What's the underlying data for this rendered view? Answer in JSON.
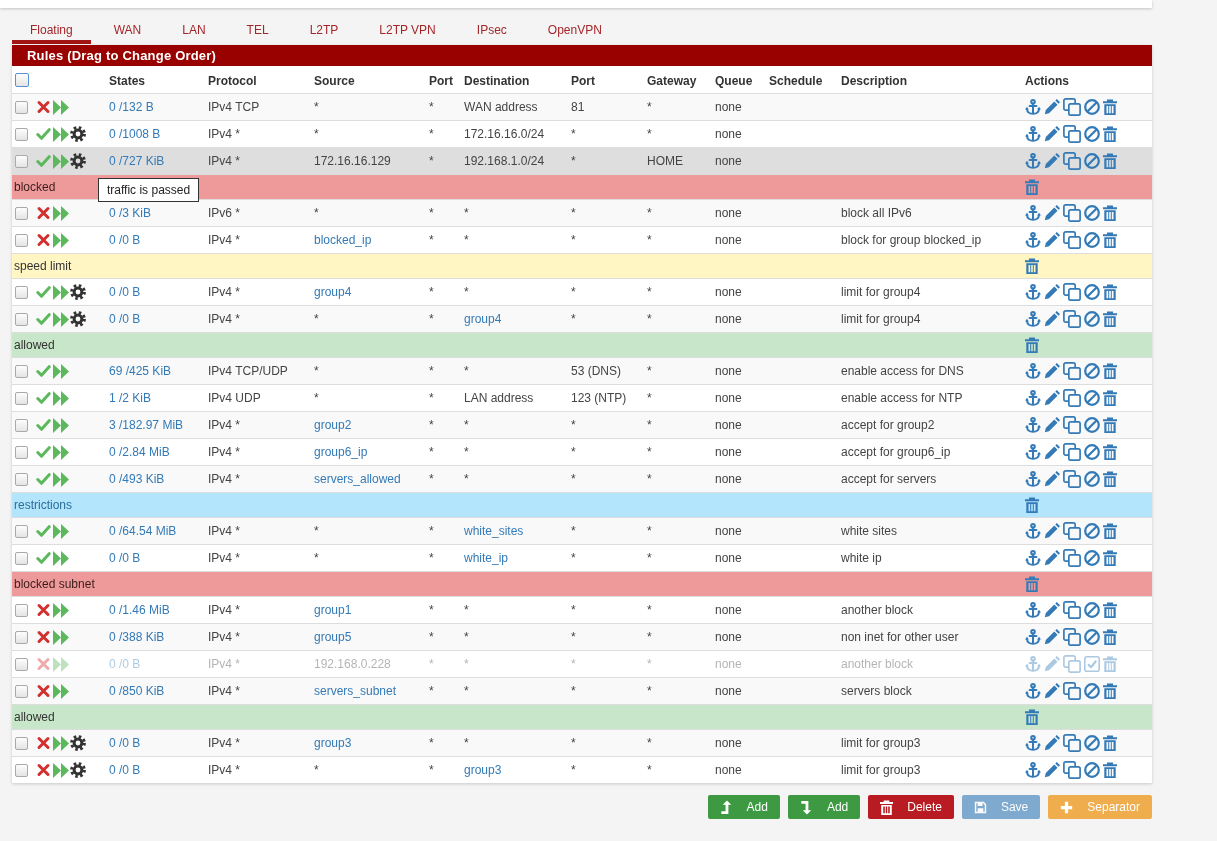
{
  "tabs": [
    {
      "label": "Floating",
      "selected": true
    },
    {
      "label": "WAN",
      "selected": false
    },
    {
      "label": "LAN",
      "selected": false
    },
    {
      "label": "TEL",
      "selected": false
    },
    {
      "label": "L2TP",
      "selected": false
    },
    {
      "label": "L2TP VPN",
      "selected": false
    },
    {
      "label": "IPsec",
      "selected": false
    },
    {
      "label": "OpenVPN",
      "selected": false
    }
  ],
  "panel": {
    "title": "Rules (Drag to Change Order)"
  },
  "table": {
    "select_all": {
      "checked": false
    },
    "columns": [
      "States",
      "Protocol",
      "Source",
      "Port",
      "Destination",
      "Port",
      "Gateway",
      "Queue",
      "Schedule",
      "Description",
      "Actions"
    ],
    "rows": [
      {
        "kind": "rule",
        "checked": false,
        "pass": false,
        "gear": false,
        "disabled": false,
        "highlighted": false,
        "states": "0 /132 B",
        "protocol": "IPv4 TCP",
        "source": "*",
        "source_alias": false,
        "source_port": "*",
        "destination": "WAN address",
        "destination_alias": false,
        "destination_port": "81",
        "gateway": "*",
        "queue": "none"
      },
      {
        "kind": "rule",
        "checked": false,
        "pass": true,
        "gear": true,
        "disabled": false,
        "highlighted": false,
        "states": "0 /1008 B",
        "protocol": "IPv4 *",
        "source": "*",
        "source_alias": false,
        "source_port": "*",
        "destination": "172.16.16.0/24",
        "destination_alias": false,
        "destination_port": "*",
        "gateway": "*",
        "queue": "none"
      },
      {
        "kind": "rule",
        "checked": false,
        "pass": true,
        "gear": true,
        "disabled": false,
        "highlighted": true,
        "states": "0 /727 KiB",
        "protocol": "IPv4 *",
        "source": "172.16.16.129",
        "source_alias": false,
        "source_port": "*",
        "destination": "192.168.1.0/24",
        "destination_alias": false,
        "destination_port": "*",
        "gateway": "HOME",
        "queue": "none"
      },
      {
        "kind": "separator",
        "label": "blocked",
        "color": "#ef9a9a"
      },
      {
        "kind": "rule",
        "checked": false,
        "pass": false,
        "gear": false,
        "disabled": false,
        "highlighted": false,
        "states": "0 /3 KiB",
        "protocol": "IPv6 *",
        "source": "*",
        "source_alias": false,
        "source_port": "*",
        "destination": "*",
        "destination_alias": false,
        "destination_port": "*",
        "gateway": "*",
        "queue": "none",
        "description": "block all IPv6"
      },
      {
        "kind": "rule",
        "checked": false,
        "pass": false,
        "gear": false,
        "disabled": false,
        "highlighted": false,
        "states": "0 /0 B",
        "protocol": "IPv4 *",
        "source": "blocked_ip",
        "source_alias": true,
        "source_port": "*",
        "destination": "*",
        "destination_alias": false,
        "destination_port": "*",
        "gateway": "*",
        "queue": "none",
        "description": "block for group blocked_ip"
      },
      {
        "kind": "separator",
        "label": "speed limit",
        "color": "#fff6c4"
      },
      {
        "kind": "rule",
        "checked": false,
        "pass": true,
        "gear": true,
        "disabled": false,
        "highlighted": false,
        "states": "0 /0 B",
        "protocol": "IPv4 *",
        "source": "group4",
        "source_alias": true,
        "source_port": "*",
        "destination": "*",
        "destination_alias": false,
        "destination_port": "*",
        "gateway": "*",
        "queue": "none",
        "description": "limit for group4"
      },
      {
        "kind": "rule",
        "checked": false,
        "pass": true,
        "gear": true,
        "disabled": false,
        "highlighted": false,
        "states": "0 /0 B",
        "protocol": "IPv4 *",
        "source": "*",
        "source_alias": false,
        "source_port": "*",
        "destination": "group4",
        "destination_alias": true,
        "destination_port": "*",
        "gateway": "*",
        "queue": "none",
        "description": "limit for group4"
      },
      {
        "kind": "separator",
        "label": "allowed",
        "color": "#c8e6c9"
      },
      {
        "kind": "rule",
        "checked": false,
        "pass": true,
        "gear": false,
        "disabled": false,
        "highlighted": false,
        "states": "69 /425 KiB",
        "protocol": "IPv4 TCP/UDP",
        "source": "*",
        "source_alias": false,
        "source_port": "*",
        "destination": "*",
        "destination_alias": false,
        "destination_port": "53 (DNS)",
        "gateway": "*",
        "queue": "none",
        "description": "enable access for DNS"
      },
      {
        "kind": "rule",
        "checked": false,
        "pass": true,
        "gear": false,
        "disabled": false,
        "highlighted": false,
        "states": "1 /2 KiB",
        "protocol": "IPv4 UDP",
        "source": "*",
        "source_alias": false,
        "source_port": "*",
        "destination": "LAN address",
        "destination_alias": false,
        "destination_port": "123 (NTP)",
        "gateway": "*",
        "queue": "none",
        "description": "enable access for NTP"
      },
      {
        "kind": "rule",
        "checked": false,
        "pass": true,
        "gear": false,
        "disabled": false,
        "highlighted": false,
        "states": "3 /182.97 MiB",
        "protocol": "IPv4 *",
        "source": "group2",
        "source_alias": true,
        "source_port": "*",
        "destination": "*",
        "destination_alias": false,
        "destination_port": "*",
        "gateway": "*",
        "queue": "none",
        "description": "accept for group2"
      },
      {
        "kind": "rule",
        "checked": false,
        "pass": true,
        "gear": false,
        "disabled": false,
        "highlighted": false,
        "states": "0 /2.84 MiB",
        "protocol": "IPv4 *",
        "source": "group6_ip",
        "source_alias": true,
        "source_port": "*",
        "destination": "*",
        "destination_alias": false,
        "destination_port": "*",
        "gateway": "*",
        "queue": "none",
        "description": "accept for group6_ip"
      },
      {
        "kind": "rule",
        "checked": false,
        "pass": true,
        "gear": false,
        "disabled": false,
        "highlighted": false,
        "states": "0 /493 KiB",
        "protocol": "IPv4 *",
        "source": "servers_allowed",
        "source_alias": true,
        "source_port": "*",
        "destination": "*",
        "destination_alias": false,
        "destination_port": "*",
        "gateway": "*",
        "queue": "none",
        "description": "accept for servers"
      },
      {
        "kind": "separator",
        "label": "restrictions",
        "color": "#b3e5fc"
      },
      {
        "kind": "rule",
        "checked": false,
        "pass": true,
        "gear": false,
        "disabled": false,
        "highlighted": false,
        "states": "0 /64.54 MiB",
        "protocol": "IPv4 *",
        "source": "*",
        "source_alias": false,
        "source_port": "*",
        "destination": "white_sites",
        "destination_alias": true,
        "destination_port": "*",
        "gateway": "*",
        "queue": "none",
        "description": "white sites"
      },
      {
        "kind": "rule",
        "checked": false,
        "pass": true,
        "gear": false,
        "disabled": false,
        "highlighted": false,
        "states": "0 /0 B",
        "protocol": "IPv4 *",
        "source": "*",
        "source_alias": false,
        "source_port": "*",
        "destination": "white_ip",
        "destination_alias": true,
        "destination_port": "*",
        "gateway": "*",
        "queue": "none",
        "description": "white ip"
      },
      {
        "kind": "separator",
        "label": "blocked subnet",
        "color": "#ef9a9a"
      },
      {
        "kind": "rule",
        "checked": false,
        "pass": false,
        "gear": false,
        "disabled": false,
        "highlighted": false,
        "states": "0 /1.46 MiB",
        "protocol": "IPv4 *",
        "source": "group1",
        "source_alias": true,
        "source_port": "*",
        "destination": "*",
        "destination_alias": false,
        "destination_port": "*",
        "gateway": "*",
        "queue": "none",
        "description": "another block"
      },
      {
        "kind": "rule",
        "checked": false,
        "pass": false,
        "gear": false,
        "disabled": false,
        "highlighted": false,
        "states": "0 /388 KiB",
        "protocol": "IPv4 *",
        "source": "group5",
        "source_alias": true,
        "source_port": "*",
        "destination": "*",
        "destination_alias": false,
        "destination_port": "*",
        "gateway": "*",
        "queue": "none",
        "description": "non inet for other user"
      },
      {
        "kind": "rule",
        "checked": false,
        "pass": false,
        "gear": false,
        "disabled": true,
        "highlighted": false,
        "states": "0 /0 B",
        "protocol": "IPv4 *",
        "source": "192.168.0.228",
        "source_alias": false,
        "source_port": "*",
        "destination": "*",
        "destination_alias": false,
        "destination_port": "*",
        "gateway": "*",
        "queue": "none",
        "description": "another block"
      },
      {
        "kind": "rule",
        "checked": false,
        "pass": false,
        "gear": false,
        "disabled": false,
        "highlighted": false,
        "states": "0 /850 KiB",
        "protocol": "IPv4 *",
        "source": "servers_subnet",
        "source_alias": true,
        "source_port": "*",
        "destination": "*",
        "destination_alias": false,
        "destination_port": "*",
        "gateway": "*",
        "queue": "none",
        "description": "servers block"
      },
      {
        "kind": "separator",
        "label": "allowed",
        "color": "#c8e6c9"
      },
      {
        "kind": "rule",
        "checked": false,
        "pass": false,
        "gear": true,
        "disabled": false,
        "highlighted": false,
        "states": "0 /0 B",
        "protocol": "IPv4 *",
        "source": "group3",
        "source_alias": true,
        "source_port": "*",
        "destination": "*",
        "destination_alias": false,
        "destination_port": "*",
        "gateway": "*",
        "queue": "none",
        "description": "limit for group3"
      },
      {
        "kind": "rule",
        "checked": false,
        "pass": false,
        "gear": true,
        "disabled": false,
        "highlighted": false,
        "states": "0 /0 B",
        "protocol": "IPv4 *",
        "source": "*",
        "source_alias": false,
        "source_port": "*",
        "destination": "group3",
        "destination_alias": true,
        "destination_port": "*",
        "gateway": "*",
        "queue": "none",
        "description": "limit for group3"
      }
    ]
  },
  "tooltip": {
    "text": "traffic is passed"
  },
  "buttons": [
    {
      "kind": "add-top",
      "label": "Add",
      "disabled": false
    },
    {
      "kind": "add-bottom",
      "label": "Add",
      "disabled": false
    },
    {
      "kind": "delete",
      "label": "Delete",
      "disabled": false
    },
    {
      "kind": "save",
      "label": "Save",
      "disabled": true
    },
    {
      "kind": "separator",
      "label": "Separator",
      "disabled": false
    }
  ]
}
